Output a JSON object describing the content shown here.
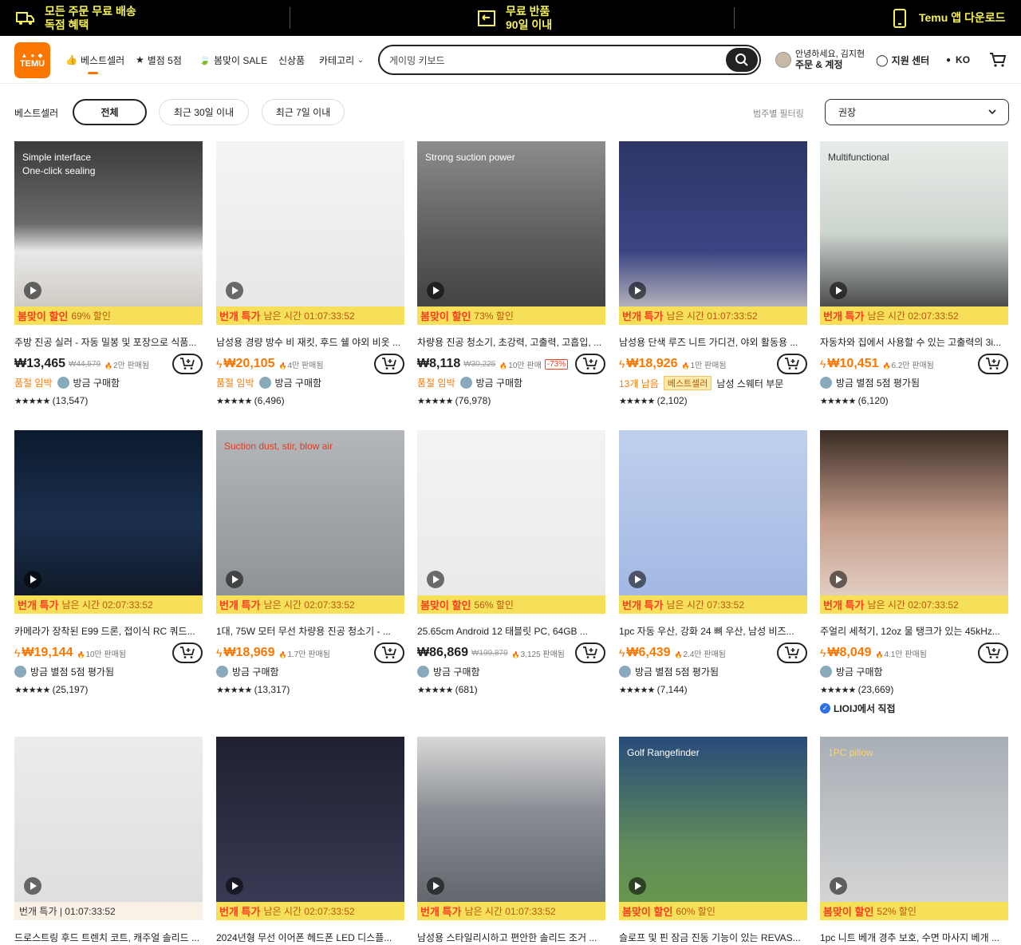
{
  "topbar": {
    "free_shipping": "모든 주문 무료 배송",
    "exclusive": "독점 혜택",
    "free_return": "무료 반품",
    "within_90": "90일 이내",
    "app_download": "Temu 앱 다운로드"
  },
  "header": {
    "logo": "TEMU",
    "nav": {
      "bestseller": "베스트셀러",
      "five_star": "별점 5점",
      "spring_sale": "봄맞이 SALE",
      "new": "신상품",
      "category": "카테고리"
    },
    "search_value": "게이밍 키보드",
    "greeting": "안녕하세요, 김지현",
    "orders_account": "주문 & 계정",
    "support": "지원 센터",
    "language": "KO"
  },
  "filters": {
    "label": "베스트셀러",
    "chips": [
      "전체",
      "최근 30일 이내",
      "최근 7일 이내"
    ],
    "category_filter": "범주별 필터링",
    "sort": "권장"
  },
  "colors": {
    "accent": "#fb7701",
    "promo_yellow": "#f6e05a",
    "promo_red": "#fb3c1f"
  },
  "products": [
    {
      "img_text": "Simple interface\nOne-click sealing",
      "promo_badge": "봄맞이 할인",
      "promo_text": "69% 할인",
      "title": "주방 진공 실러 - 자동 밀봉 및 포장으로 식품...",
      "price": "₩13,465",
      "orig": "₩44,579",
      "sold": "2만 판매됨",
      "meta_tag": "품절 임박",
      "meta_text": "방금 구매함",
      "stars": "★★★★★",
      "reviews": "(13,547)"
    },
    {
      "img_text": "",
      "promo_badge": "번개 특가",
      "promo_text": "남은 시간 01:07:33:52",
      "title": "남성용 경량 방수 비 재킷, 후드 쉘 야외 비옷 ...",
      "price": "₩20,105",
      "orig": "",
      "sold": "4만 판매됨",
      "meta_tag": "품절 임박",
      "meta_text": "방금 구매함",
      "stars": "★★★★★",
      "reviews": "(6,496)"
    },
    {
      "img_text": "Strong suction power",
      "promo_badge": "봄맞이 할인",
      "promo_text": "73% 할인",
      "title": "차량용 진공 청소기, 초강력, 고출력, 고흡입, ...",
      "price": "₩8,118",
      "orig": "₩30,225",
      "sold": "10만 판매",
      "disc": "-73%",
      "meta_tag": "품절 임박",
      "meta_text": "방금 구매함",
      "stars": "★★★★★",
      "reviews": "(76,978)"
    },
    {
      "img_text": "",
      "promo_badge": "번개 특가",
      "promo_text": "남은 시간 01:07:33:52",
      "title": "남성용 단색 루즈 니트 가디건, 야외 활동용 ...",
      "price": "₩18,926",
      "orig": "",
      "sold": "1만 판매됨",
      "meta_tag": "13개 남음",
      "meta_badge": "베스트셀러",
      "meta_text": "남성 스웨터 부문",
      "stars": "★★★★★",
      "reviews": "(2,102)"
    },
    {
      "img_text": "Multifunctional",
      "promo_badge": "번개 특가",
      "promo_text": "남은 시간 02:07:33:52",
      "title": "자동차와 집에서 사용할 수 있는 고출력의 3i...",
      "price": "₩10,451",
      "orig": "",
      "sold": "6.2만 판매됨",
      "meta_tag": "",
      "meta_text": "방금 별점 5점 평가됨",
      "stars": "★★★★★",
      "reviews": "(6,120)"
    },
    {
      "img_text": "",
      "promo_badge": "번개 특가",
      "promo_text": "남은 시간 02:07:33:52",
      "title": "카메라가 장착된 E99 드론, 접이식 RC 쿼드...",
      "price": "₩19,144",
      "orig": "",
      "sold": "10만 판매됨",
      "meta_tag": "",
      "meta_text": "방금 별점 5점 평가됨",
      "stars": "★★★★★",
      "reviews": "(25,197)"
    },
    {
      "img_text": "Suction dust, stir, blow air",
      "promo_badge": "번개 특가",
      "promo_text": "남은 시간 02:07:33:52",
      "title": "1대, 75W 모터 무선 차량용 진공 청소기 - ...",
      "price": "₩18,969",
      "orig": "",
      "sold": "1.7만 판매됨",
      "meta_tag": "",
      "meta_text": "방금 구매함",
      "stars": "★★★★★",
      "reviews": "(13,317)"
    },
    {
      "img_text": "",
      "promo_badge": "봄맞이 할인",
      "promo_text": "56% 할인",
      "title": "25.65cm Android 12 태블릿 PC, 64GB ...",
      "price": "₩86,869",
      "orig": "₩199,879",
      "sold": "3,125 판매됨",
      "meta_tag": "",
      "meta_text": "방금 구매함",
      "stars": "★★★★★",
      "reviews": "(681)"
    },
    {
      "img_text": "",
      "promo_badge": "번개 특가",
      "promo_text": "남은 시간 07:33:52",
      "title": "1pc 자동 우산, 강화 24 뼈 우산, 남성 비즈...",
      "price": "₩6,439",
      "orig": "",
      "sold": "2.4만 판매됨",
      "meta_tag": "",
      "meta_text": "방금 별점 5점 평가됨",
      "stars": "★★★★★",
      "reviews": "(7,144)"
    },
    {
      "img_text": "",
      "promo_badge": "번개 특가",
      "promo_text": "남은 시간 02:07:33:52",
      "title": "주얼리 세척기, 12oz 물 탱크가 있는 45kHz...",
      "price": "₩8,049",
      "orig": "",
      "sold": "4.1만 판매됨",
      "meta_tag": "",
      "meta_text": "방금 구매함",
      "stars": "★★★★★",
      "reviews": "(23,669)",
      "extra": "LIOIJ에서 직접"
    },
    {
      "img_text": "",
      "promo_badge": "",
      "promo_text": "번개 특가 | 01:07:33:52",
      "title": "드로스트링 후드 트렌치 코트, 캐주얼 솔리드 ...",
      "price": "",
      "orig": "",
      "sold": "",
      "meta_tag": "",
      "meta_text": "",
      "stars": "",
      "reviews": ""
    },
    {
      "img_text": "",
      "promo_badge": "번개 특가",
      "promo_text": "남은 시간 02:07:33:52",
      "title": "2024년형 무선 이어폰 헤드폰 LED 디스플...",
      "price": "",
      "orig": "",
      "sold": "",
      "meta_tag": "",
      "meta_text": "",
      "stars": "",
      "reviews": ""
    },
    {
      "img_text": "",
      "promo_badge": "번개 특가",
      "promo_text": "남은 시간 01:07:33:52",
      "title": "남성용 스타일리시하고 편안한 솔리드 조거 ...",
      "price": "",
      "orig": "",
      "sold": "",
      "meta_tag": "",
      "meta_text": "",
      "stars": "",
      "reviews": ""
    },
    {
      "img_text": "Golf Rangefinder",
      "promo_badge": "봄맞이 할인",
      "promo_text": "60% 할인",
      "title": "슬로프 및 핀 잠금 진동 기능이 있는 REVAS...",
      "price": "",
      "orig": "",
      "sold": "",
      "meta_tag": "",
      "meta_text": "",
      "stars": "",
      "reviews": ""
    },
    {
      "img_text": "1PC pillow",
      "promo_badge": "봄맞이 할인",
      "promo_text": "52% 할인",
      "title": "1pc 니트 베개 경추 보호, 수면 마사지 베개 ...",
      "price": "",
      "orig": "",
      "sold": "",
      "meta_tag": "",
      "meta_text": "",
      "stars": "",
      "reviews": ""
    }
  ]
}
